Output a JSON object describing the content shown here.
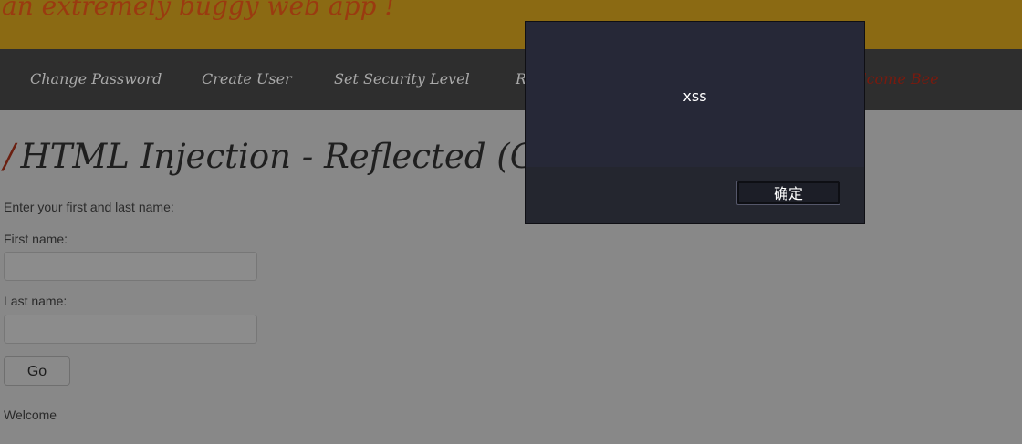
{
  "header": {
    "tagline": "an extremely buggy web app !"
  },
  "menu": {
    "items": [
      {
        "label": "Change Password"
      },
      {
        "label": "Create User"
      },
      {
        "label": "Set Security Level"
      },
      {
        "label": "R"
      }
    ],
    "welcome_user": "elcome Bee"
  },
  "main": {
    "title_slash": "/",
    "title": "HTML Injection - Reflected (GE",
    "instructions": "Enter your first and last name:",
    "first_name_label": "First name:",
    "first_name_value": "",
    "last_name_label": "Last name:",
    "last_name_value": "",
    "go_label": "Go",
    "welcome_text": "Welcome"
  },
  "dialog": {
    "message": "xss",
    "ok_label": "确定"
  },
  "colors": {
    "overlay_bg": "#888888",
    "header_band": "#8b6a13",
    "menu_bg": "#2e2e2e",
    "dialog_bg": "#262837"
  }
}
